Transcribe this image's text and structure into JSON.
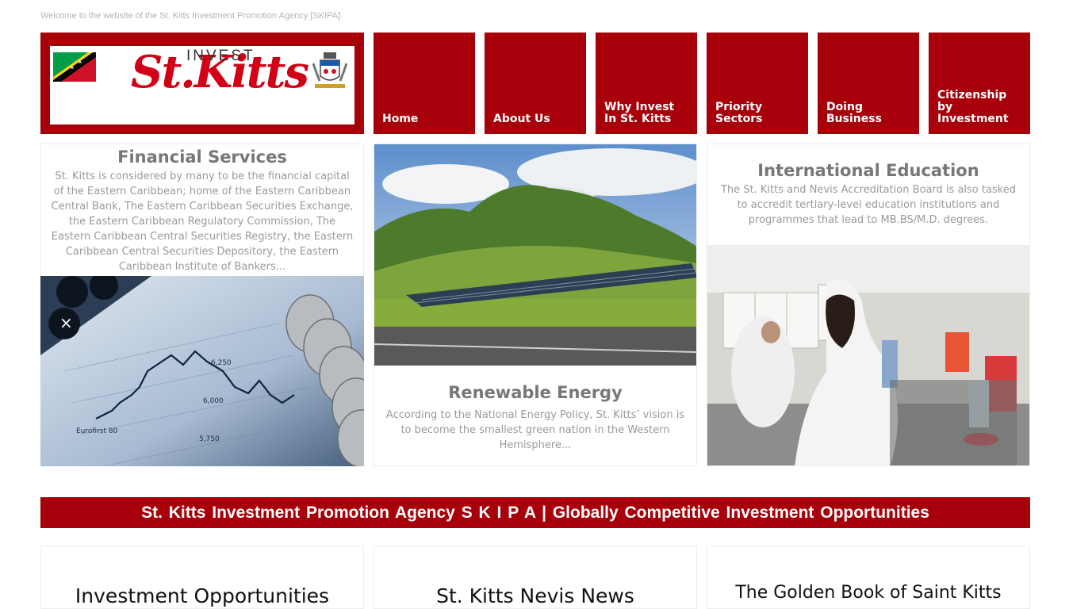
{
  "header": {
    "welcome": "Welcome to the website of the St. Kitts Investment Promotion Agency [SKIPA].",
    "logo": {
      "invest": "INVEST",
      "brand": "St.Kitts"
    }
  },
  "nav": {
    "items": [
      {
        "label": "Home"
      },
      {
        "label": "About Us"
      },
      {
        "label": "Why Invest In St. Kitts"
      },
      {
        "label": "Priority Sectors"
      },
      {
        "label": "Doing Business"
      },
      {
        "label": "Citizenship by Investment"
      }
    ]
  },
  "features": {
    "financial": {
      "title": "Financial Services",
      "text": "St. Kitts is considered by many to be the financial capital of the Eastern Caribbean; home of the Eastern Caribbean Central Bank, The Eastern Caribbean Securities Exchange, the Eastern Caribbean Regulatory Commission, The Eastern Caribbean Central Securities Registry, the Eastern Caribbean Central Securities Depository, the Eastern Caribbean Institute of Bankers...",
      "image_labels": [
        "6,250",
        "6,000",
        "5,750",
        "Eurofirst 80"
      ]
    },
    "renewable": {
      "title": "Renewable Energy",
      "text": "According to the National Energy Policy, St. Kitts’ vision is to become the smallest green nation in the Western Hemisphere..."
    },
    "education": {
      "title": "International Education",
      "text": "The St. Kitts and Nevis Accreditation Board is also tasked to accredit tertiary-level education institutions and programmes that lead to MB.BS/M.D. degrees."
    }
  },
  "banner": {
    "text": "St. Kitts Investment Promotion Agency  S K I P A  |  Globally  Competitive  Investment  Opportunities"
  },
  "bottom": {
    "cards": [
      {
        "title": "Investment Opportunities"
      },
      {
        "title": "St. Kitts Nevis News"
      },
      {
        "title": "The Golden Book of Saint Kitts"
      }
    ]
  },
  "colors": {
    "brand_red": "#a8000a",
    "heading_gray": "#777777",
    "text_gray": "#9a9a9a"
  }
}
